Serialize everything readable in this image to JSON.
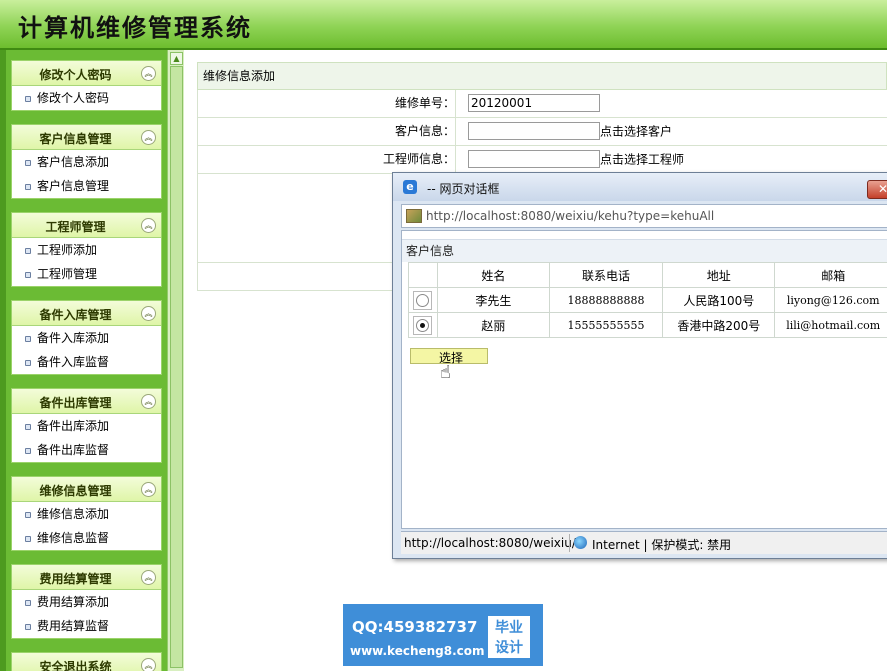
{
  "app": {
    "title": "计算机维修管理系统"
  },
  "sidebar": {
    "panels": [
      {
        "title": "修改个人密码",
        "items": [
          "修改个人密码"
        ]
      },
      {
        "title": "客户信息管理",
        "items": [
          "客户信息添加",
          "客户信息管理"
        ]
      },
      {
        "title": "工程师管理",
        "items": [
          "工程师添加",
          "工程师管理"
        ]
      },
      {
        "title": "备件入库管理",
        "items": [
          "备件入库添加",
          "备件入库监督"
        ]
      },
      {
        "title": "备件出库管理",
        "items": [
          "备件出库添加",
          "备件出库监督"
        ]
      },
      {
        "title": "维修信息管理",
        "items": [
          "维修信息添加",
          "维修信息监督"
        ]
      },
      {
        "title": "费用结算管理",
        "items": [
          "费用结算添加",
          "费用结算监督"
        ]
      },
      {
        "title": "安全退出系统",
        "items": []
      }
    ]
  },
  "form": {
    "caption": "维修信息添加",
    "order_no_label": "维修单号：",
    "order_no_value": "20120001",
    "customer_label": "客户信息：",
    "customer_value": "",
    "customer_link": "点击选择客户",
    "engineer_label": "工程师信息：",
    "engineer_value": "",
    "engineer_link": "点击选择工程师"
  },
  "dialog": {
    "title": "-- 网页对话框",
    "address": "http://localhost:8080/weixiu/kehu?type=kehuAll",
    "caption": "客户信息",
    "columns": [
      "姓名",
      "联系电话",
      "地址",
      "邮箱"
    ],
    "rows": [
      {
        "selected": false,
        "name": "李先生",
        "phone": "18888888888",
        "address": "人民路100号",
        "email": "liyong@126.com"
      },
      {
        "selected": true,
        "name": "赵丽",
        "phone": "15555555555",
        "address": "香港中路200号",
        "email": "lili@hotmail.com"
      }
    ],
    "select_button": "选择",
    "status_url": "http://localhost:8080/weixiu/",
    "status_zone": "Internet | 保护模式: 禁用"
  },
  "watermark": {
    "qq": "QQ:459382737",
    "site": "www.kecheng8.com",
    "badge_line1": "毕业",
    "badge_line2": "设计"
  },
  "colors": {
    "header_green": "#8fd356",
    "sidebar_green": "#6bbb34",
    "panel_header": "#dff5a8",
    "dialog_frame": "#dce6f2",
    "watermark_blue": "#3f8ed8"
  }
}
